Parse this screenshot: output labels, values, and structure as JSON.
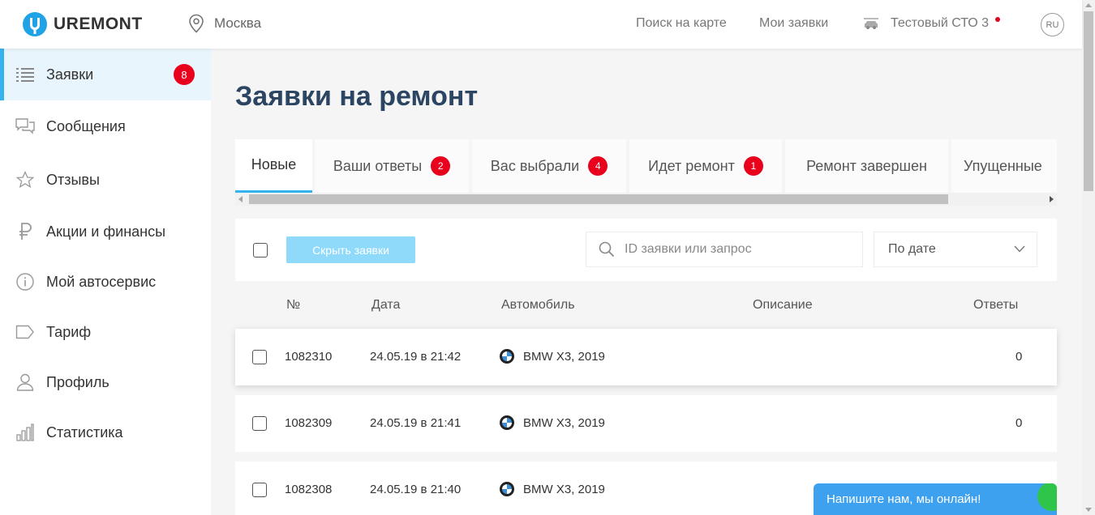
{
  "header": {
    "logo_text": "UREMONT",
    "city": "Москва",
    "nav": [
      "Поиск на карте",
      "Мои заявки"
    ],
    "service_name": "Тестовый СТО 3",
    "language": "RU"
  },
  "sidebar": {
    "items": [
      {
        "label": "Заявки",
        "icon": "list-icon",
        "badge": "8",
        "active": true
      },
      {
        "label": "Сообщения",
        "icon": "messages-icon"
      },
      {
        "label": "Отзывы",
        "icon": "star-icon"
      },
      {
        "label": "Акции и финансы",
        "icon": "ruble-icon"
      },
      {
        "label": "Мой автосервис",
        "icon": "info-icon"
      },
      {
        "label": "Тариф",
        "icon": "tag-icon"
      },
      {
        "label": "Профиль",
        "icon": "user-icon"
      },
      {
        "label": "Статистика",
        "icon": "stats-icon"
      }
    ]
  },
  "main": {
    "title": "Заявки на ремонт",
    "tabs": [
      {
        "label": "Новые",
        "active": true
      },
      {
        "label": "Ваши ответы",
        "badge": "2"
      },
      {
        "label": "Вас выбрали",
        "badge": "4"
      },
      {
        "label": "Идет ремонт",
        "badge": "1"
      },
      {
        "label": "Ремонт завершен"
      },
      {
        "label": "Упущенные"
      }
    ],
    "toolbar": {
      "hide_button": "Скрыть заявки",
      "search_placeholder": "ID заявки или запрос",
      "sort_value": "По дате"
    },
    "table": {
      "columns": [
        "№",
        "Дата",
        "Автомобиль",
        "Описание",
        "Ответы"
      ],
      "rows": [
        {
          "id": "1082310",
          "date": "24.05.19 в 21:42",
          "car": "BMW X3, 2019",
          "description": "",
          "answers": "0"
        },
        {
          "id": "1082309",
          "date": "24.05.19 в 21:41",
          "car": "BMW X3, 2019",
          "description": "",
          "answers": "0"
        },
        {
          "id": "1082308",
          "date": "24.05.19 в 21:40",
          "car": "BMW X3, 2019",
          "description": "",
          "answers": ""
        }
      ]
    }
  },
  "chat": {
    "label": "Напишите нам, мы онлайн!"
  },
  "colors": {
    "accent": "#35b3ee",
    "badge": "#e8001c",
    "title": "#2b4563",
    "chat": "#3da1f0"
  }
}
